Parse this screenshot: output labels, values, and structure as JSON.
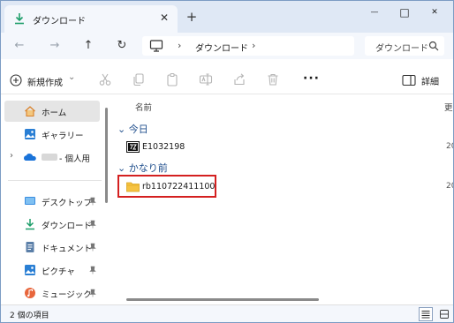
{
  "tab": {
    "title": "ダウンロード",
    "close": "✕",
    "new": "+"
  },
  "window_controls": {
    "minimize": "—",
    "maximize": "□",
    "close": "✕"
  },
  "nav": {
    "back": "←",
    "forward": "→",
    "up": "↑",
    "refresh": "↻"
  },
  "address": {
    "separator": "›",
    "crumbs": [
      "ダウンロード"
    ],
    "trailing_separator": "›"
  },
  "search": {
    "placeholder": "ダウンロード"
  },
  "commands": {
    "new_label": "新規作成",
    "new_chevron": "⌄",
    "more": "···",
    "details_label": "詳細"
  },
  "sidebar": {
    "items": [
      {
        "label": "ホーム",
        "icon": "home-icon",
        "selected": true
      },
      {
        "label": "ギャラリー",
        "icon": "gallery-icon"
      },
      {
        "label": "- 個人用",
        "icon": "onedrive-icon",
        "expand": "›"
      }
    ],
    "quick_access": [
      {
        "label": "デスクトップ",
        "icon": "desktop-icon",
        "pinned": true
      },
      {
        "label": "ダウンロード",
        "icon": "download-icon",
        "pinned": true
      },
      {
        "label": "ドキュメント",
        "icon": "documents-icon",
        "pinned": true
      },
      {
        "label": "ピクチャ",
        "icon": "pictures-icon",
        "pinned": true
      },
      {
        "label": "ミュージック",
        "icon": "music-icon",
        "pinned": true
      }
    ]
  },
  "list": {
    "column_name": "名前",
    "column_date": "更",
    "groups": [
      {
        "label": "今日",
        "chevron": "⌄",
        "files": [
          {
            "name": "E1032198",
            "icon": "7z-archive-icon",
            "date": "20"
          }
        ]
      },
      {
        "label": "かなり前",
        "chevron": "⌄",
        "files": [
          {
            "name": "rb110722411100",
            "icon": "folder-icon",
            "date": "20"
          }
        ]
      }
    ]
  },
  "status": {
    "text": "2 個の項目"
  },
  "colors": {
    "accent": "#1f4e8c",
    "folder": "#f6c342",
    "highlight": "#d42020",
    "chrome": "#dfe8f5"
  }
}
